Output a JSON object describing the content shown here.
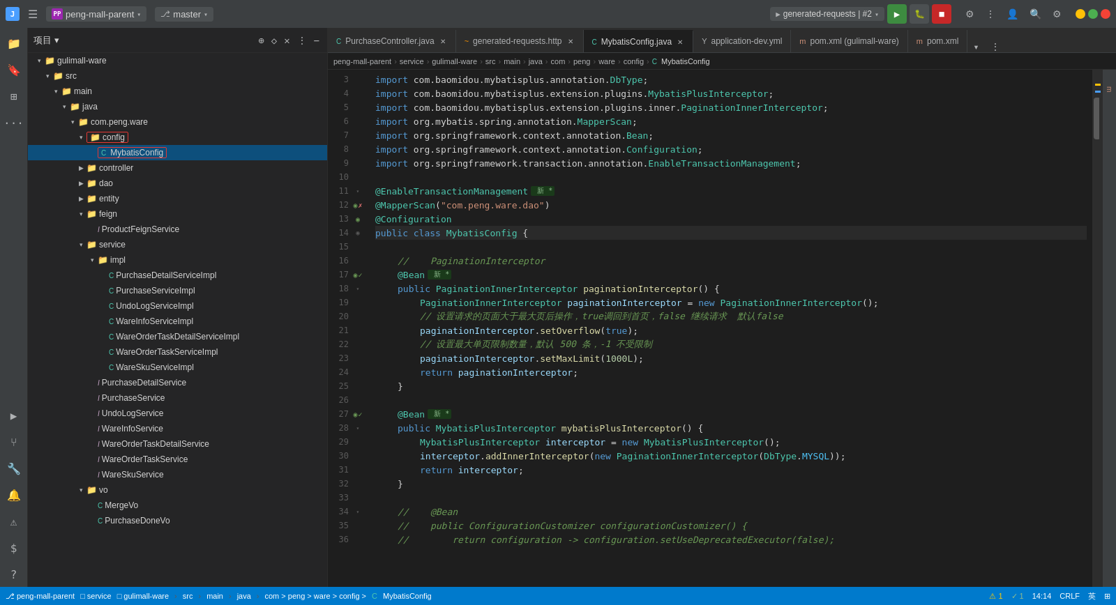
{
  "titlebar": {
    "logo": "J",
    "menu_btn": "☰",
    "project_icon": "PP",
    "project_name": "peng-mall-parent",
    "branch_icon": "⎇",
    "branch_name": "master",
    "run_config": "generated-requests | #2",
    "search_icon": "🔍",
    "settings_icon": "⚙",
    "more_icon": "⋮",
    "account_icon": "👤",
    "window_min": "−",
    "window_max": "□",
    "window_close": "✕"
  },
  "tabs": [
    {
      "id": "purchase-controller",
      "icon": "C",
      "icon_type": "java",
      "label": "PurchaseController.java",
      "active": false,
      "closable": true
    },
    {
      "id": "generated-requests",
      "icon": "~",
      "icon_type": "http",
      "label": "generated-requests.http",
      "active": false,
      "closable": true
    },
    {
      "id": "mybatis-config",
      "icon": "C",
      "icon_type": "java",
      "label": "MybatisConfig.java",
      "active": true,
      "closable": true
    },
    {
      "id": "application-dev",
      "icon": "Y",
      "icon_type": "yml",
      "label": "application-dev.yml",
      "active": false,
      "closable": false
    },
    {
      "id": "pom-gulimall-ware",
      "icon": "m",
      "icon_type": "xml",
      "label": "pom.xml (gulimall-ware)",
      "active": false,
      "closable": false
    },
    {
      "id": "pom-xml",
      "icon": "m",
      "icon_type": "xml",
      "label": "pom.xml",
      "active": false,
      "closable": false
    }
  ],
  "breadcrumb": {
    "items": [
      "peng-mall-parent",
      "service",
      "gulimall-ware",
      "src",
      "main",
      "java",
      "com",
      "peng",
      "ware",
      "config",
      "MybatisConfig"
    ]
  },
  "sidebar": {
    "title": "项目 ▾",
    "tree": [
      {
        "id": "gulimall-ware",
        "indent": 0,
        "type": "folder",
        "label": "gulimall-ware",
        "expanded": true,
        "arrow": "▾"
      },
      {
        "id": "src",
        "indent": 1,
        "type": "folder",
        "label": "src",
        "expanded": true,
        "arrow": "▾"
      },
      {
        "id": "main",
        "indent": 2,
        "type": "folder",
        "label": "main",
        "expanded": true,
        "arrow": "▾"
      },
      {
        "id": "java",
        "indent": 3,
        "type": "folder",
        "label": "java",
        "expanded": true,
        "arrow": "▾"
      },
      {
        "id": "com-peng-ware",
        "indent": 4,
        "type": "folder",
        "label": "com.peng.ware",
        "expanded": true,
        "arrow": "▾"
      },
      {
        "id": "config",
        "indent": 5,
        "type": "folder",
        "label": "config",
        "expanded": true,
        "arrow": "▾",
        "outlined": true
      },
      {
        "id": "mybatis-config",
        "indent": 6,
        "type": "class",
        "label": "MybatisConfig",
        "selected": true,
        "outlined": true
      },
      {
        "id": "controller",
        "indent": 5,
        "type": "folder",
        "label": "controller",
        "expanded": false,
        "arrow": "▶"
      },
      {
        "id": "dao",
        "indent": 5,
        "type": "folder",
        "label": "dao",
        "expanded": false,
        "arrow": "▶"
      },
      {
        "id": "entity",
        "indent": 5,
        "type": "folder",
        "label": "entity",
        "expanded": false,
        "arrow": "▶"
      },
      {
        "id": "feign",
        "indent": 5,
        "type": "folder",
        "label": "feign",
        "expanded": true,
        "arrow": "▾"
      },
      {
        "id": "product-feign-service",
        "indent": 6,
        "type": "interface",
        "label": "ProductFeignService"
      },
      {
        "id": "service",
        "indent": 5,
        "type": "folder",
        "label": "service",
        "expanded": true,
        "arrow": "▾"
      },
      {
        "id": "impl",
        "indent": 6,
        "type": "folder",
        "label": "impl",
        "expanded": true,
        "arrow": "▾"
      },
      {
        "id": "purchase-detail-service-impl",
        "indent": 7,
        "type": "class",
        "label": "PurchaseDetailServiceImpl"
      },
      {
        "id": "purchase-service-impl",
        "indent": 7,
        "type": "class",
        "label": "PurchaseServiceImpl"
      },
      {
        "id": "undo-log-service-impl",
        "indent": 7,
        "type": "class",
        "label": "UndoLogServiceImpl"
      },
      {
        "id": "ware-info-service-impl",
        "indent": 7,
        "type": "class",
        "label": "WareInfoServiceImpl"
      },
      {
        "id": "ware-order-task-detail-service-impl",
        "indent": 7,
        "type": "class",
        "label": "WareOrderTaskDetailServiceImpl"
      },
      {
        "id": "ware-order-task-service-impl",
        "indent": 7,
        "type": "class",
        "label": "WareOrderTaskServiceImpl"
      },
      {
        "id": "ware-sku-service-impl",
        "indent": 7,
        "type": "class",
        "label": "WareSkuServiceImpl"
      },
      {
        "id": "purchase-detail-service",
        "indent": 6,
        "type": "interface",
        "label": "PurchaseDetailService"
      },
      {
        "id": "purchase-service",
        "indent": 6,
        "type": "interface",
        "label": "PurchaseService"
      },
      {
        "id": "undo-log-service",
        "indent": 6,
        "type": "interface",
        "label": "UndoLogService"
      },
      {
        "id": "ware-info-service",
        "indent": 6,
        "type": "interface",
        "label": "WareInfoService"
      },
      {
        "id": "ware-order-task-detail-service",
        "indent": 6,
        "type": "interface",
        "label": "WareOrderTaskDetailService"
      },
      {
        "id": "ware-order-task-service",
        "indent": 6,
        "type": "interface",
        "label": "WareOrderTaskService"
      },
      {
        "id": "ware-sku-service",
        "indent": 6,
        "type": "interface",
        "label": "WareSkuService"
      },
      {
        "id": "vo",
        "indent": 5,
        "type": "folder",
        "label": "vo",
        "expanded": true,
        "arrow": "▾"
      },
      {
        "id": "merge-vo",
        "indent": 6,
        "type": "class",
        "label": "MergeVo"
      },
      {
        "id": "purchase-done-vo",
        "indent": 6,
        "type": "class",
        "label": "PurchaseDoneVo"
      }
    ]
  },
  "code_lines": [
    {
      "num": 3,
      "content": "import",
      "type": "import_line",
      "pkg": "com.baomidou.mybatisplus.annotation.",
      "cls": "DbType",
      "end": ";"
    },
    {
      "num": 4,
      "content": "import",
      "type": "import_line2",
      "pkg": "com.baomidou.mybatisplus.extension.plugins.",
      "cls": "MybatisPlusInterceptor",
      "end": ";"
    },
    {
      "num": 5,
      "content": "import",
      "type": "import_line3",
      "pkg": "com.baomidou.mybatisplus.extension.plugins.inner.",
      "cls": "PaginationInnerInterceptor",
      "end": ";"
    },
    {
      "num": 6,
      "content": "import",
      "type": "import_line4",
      "pkg": "org.mybatis.spring.annotation.",
      "cls": "MapperScan",
      "end": ";"
    },
    {
      "num": 7,
      "content": "import",
      "type": "import_line5",
      "pkg": "org.springframework.context.annotation.",
      "cls": "Bean",
      "end": ";"
    },
    {
      "num": 8,
      "content": "import",
      "type": "import_line6",
      "pkg": "org.springframework.context.annotation.",
      "cls": "Configuration",
      "end": ";"
    },
    {
      "num": 9,
      "content": "import",
      "type": "import_line7",
      "pkg": "org.springframework.transaction.annotation.",
      "cls": "EnableTransactionManagement",
      "end": ";"
    },
    {
      "num": 10,
      "content": ""
    },
    {
      "num": 11,
      "content": "@EnableTransactionManagement",
      "is_annotation": true,
      "suffix": " 新 *"
    },
    {
      "num": 12,
      "content": "@MapperScan(\"com.peng.ware.dao\")",
      "has_fold": true
    },
    {
      "num": 13,
      "content": "@Configuration",
      "has_fold": true
    },
    {
      "num": 14,
      "content": "public class MybatisConfig {",
      "has_fold_icon": true
    },
    {
      "num": 15,
      "content": ""
    },
    {
      "num": 16,
      "content": "//    PaginationInterceptor",
      "is_comment": true
    },
    {
      "num": 17,
      "content": "@Bean 新 *",
      "has_bean": true
    },
    {
      "num": 18,
      "content": "public PaginationInnerInterceptor paginationInterceptor() {",
      "has_fold": true
    },
    {
      "num": 19,
      "content": "PaginationInnerInterceptor paginationInterceptor = new PaginationInnerInterceptor();"
    },
    {
      "num": 20,
      "content": "// 设置请求的页面大于最大页后操作，true调回到首页，false 继续请求  默认false",
      "is_comment": true
    },
    {
      "num": 21,
      "content": "paginationInterceptor.setOverflow(true);"
    },
    {
      "num": 22,
      "content": "// 设置最大单页限制数量，默认 500 条，-1 不受限制",
      "is_comment": true
    },
    {
      "num": 23,
      "content": "paginationInterceptor.setMaxLimit(1000L);"
    },
    {
      "num": 24,
      "content": "return paginationInterceptor;"
    },
    {
      "num": 25,
      "content": "}"
    },
    {
      "num": 26,
      "content": ""
    },
    {
      "num": 27,
      "content": "@Bean 新 *",
      "has_bean2": true
    },
    {
      "num": 28,
      "content": "public MybatisPlusInterceptor mybatisPlusInterceptor() {",
      "has_fold": true
    },
    {
      "num": 29,
      "content": "MybatisPlusInterceptor interceptor = new MybatisPlusInterceptor();"
    },
    {
      "num": 30,
      "content": "interceptor.addInnerInterceptor(new PaginationInnerInterceptor(DbType.MYSQL));"
    },
    {
      "num": 31,
      "content": "return interceptor;"
    },
    {
      "num": 32,
      "content": "}"
    },
    {
      "num": 33,
      "content": ""
    },
    {
      "num": 34,
      "content": "//    @Bean",
      "is_comment": true
    },
    {
      "num": 35,
      "content": "//    public ConfigurationCustomizer configurationCustomizer() {",
      "is_comment": true
    },
    {
      "num": 36,
      "content": "//        return configuration -> configuration.setUseDeprecatedExecutor(false);",
      "is_comment": true
    }
  ],
  "status_bar": {
    "project_path": "peng-mall-parent",
    "module": "service",
    "submodule": "gulimall-ware",
    "src": "src",
    "main_path": "main",
    "java": "java",
    "pkg": "com > peng > ware > config >",
    "file": "MybatisConfig",
    "position": "14:14",
    "encoding": "CRLF",
    "warnings": "⚠1",
    "errors": "✓1",
    "lang": "英",
    "line_col": "14:14",
    "file_format": "CRLF"
  },
  "right_tools": [
    {
      "id": "notifications",
      "label": "m"
    }
  ],
  "colors": {
    "accent": "#007acc",
    "selected_bg": "#0d4f7c",
    "active_tab_bg": "#1e1e1e",
    "keyword": "#569cd6",
    "type_color": "#4ec9b0",
    "annotation_color": "#4ec9b0",
    "string_color": "#ce9178",
    "comment_color": "#6a9955",
    "method_color": "#dcdcaa",
    "param_color": "#9cdcfe"
  }
}
